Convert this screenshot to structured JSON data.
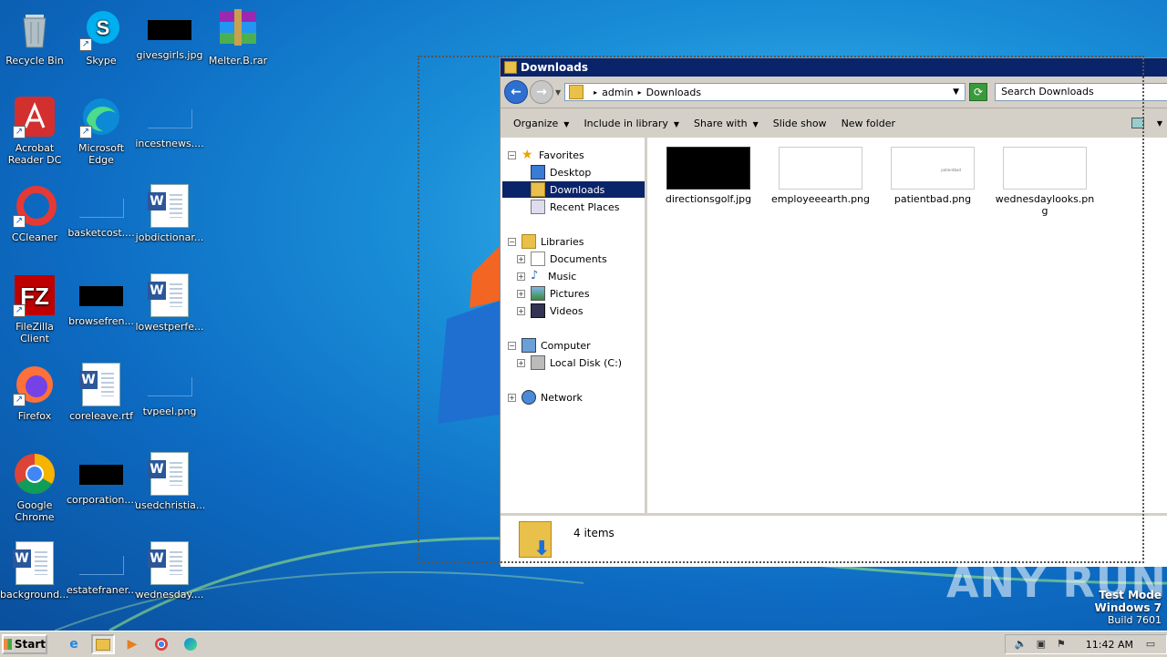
{
  "desktop": {
    "icons": [
      {
        "label": "Recycle Bin",
        "icon": "recycle-bin-icon"
      },
      {
        "label": "Skype",
        "icon": "skype-icon"
      },
      {
        "label": "givesgirls.jpg",
        "icon": "image-file-icon"
      },
      {
        "label": "Melter.B.rar",
        "icon": "winrar-icon"
      },
      {
        "label": "Acrobat Reader DC",
        "icon": "acrobat-icon"
      },
      {
        "label": "Microsoft Edge",
        "icon": "edge-icon"
      },
      {
        "label": "incestnews....",
        "icon": "image-file-icon"
      },
      {
        "label": "CCleaner",
        "icon": "ccleaner-icon"
      },
      {
        "label": "basketcost....",
        "icon": "image-file-icon"
      },
      {
        "label": "jobdictionar...",
        "icon": "word-doc-icon"
      },
      {
        "label": "FileZilla Client",
        "icon": "filezilla-icon"
      },
      {
        "label": "browsefren...",
        "icon": "image-file-icon"
      },
      {
        "label": "lowestperfe...",
        "icon": "word-doc-icon"
      },
      {
        "label": "Firefox",
        "icon": "firefox-icon"
      },
      {
        "label": "coreleave.rtf",
        "icon": "word-doc-icon"
      },
      {
        "label": "tvpeel.png",
        "icon": "image-file-icon"
      },
      {
        "label": "Google Chrome",
        "icon": "chrome-icon"
      },
      {
        "label": "corporation....",
        "icon": "image-file-icon"
      },
      {
        "label": "usedchristia...",
        "icon": "word-doc-icon"
      },
      {
        "label": "background....",
        "icon": "word-doc-icon"
      },
      {
        "label": "estatefraner...",
        "icon": "image-file-icon"
      },
      {
        "label": "wednesday....",
        "icon": "word-doc-icon"
      }
    ]
  },
  "explorer": {
    "title": "Downloads",
    "address": {
      "crumbs": [
        "admin",
        "Downloads"
      ]
    },
    "search_placeholder": "Search Downloads",
    "toolbar": {
      "organize": "Organize",
      "include": "Include in library",
      "share": "Share with",
      "slideshow": "Slide show",
      "newfolder": "New folder"
    },
    "nav": {
      "favorites": "Favorites",
      "desktop": "Desktop",
      "downloads": "Downloads",
      "recent": "Recent Places",
      "libraries": "Libraries",
      "documents": "Documents",
      "music": "Music",
      "pictures": "Pictures",
      "videos": "Videos",
      "computer": "Computer",
      "localdisk": "Local Disk (C:)",
      "network": "Network"
    },
    "files": [
      {
        "name": "directionsgolf.jpg"
      },
      {
        "name": "employeeearth.png"
      },
      {
        "name": "patientbad.png",
        "thumb_text": "patientbad"
      },
      {
        "name": "wednesdaylooks.png"
      }
    ],
    "status": "4 items"
  },
  "watermark": "ANY RUN",
  "testmode": {
    "line1": "Test Mode",
    "line2": "Windows 7",
    "line3": "Build 7601"
  },
  "taskbar": {
    "start": "Start",
    "clock": "11:42 AM"
  }
}
